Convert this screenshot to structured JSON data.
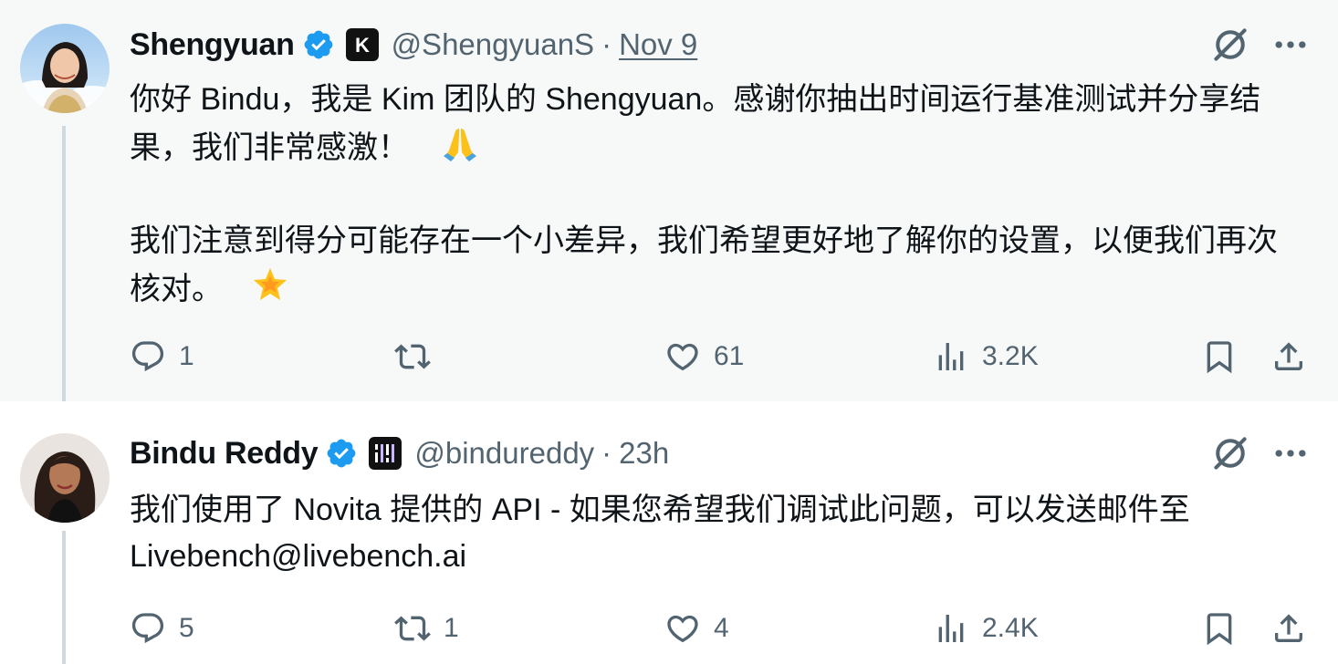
{
  "tweets": [
    {
      "author": {
        "name": "Shengyuan",
        "handle": "@ShengyuanS",
        "affiliate": "Kim"
      },
      "time": "Nov 9",
      "text": [
        "你好 Bindu，我是 Kim 团队的 Shengyuan。感谢你抽出时间运行基准测试并分享结果，我们非常感激！",
        "我们注意到得分可能存在一个小差异，我们希望更好地了解你的设置，以便我们再次核对。"
      ],
      "emojis": [
        "folded-hands",
        "glowing-star"
      ],
      "stats": {
        "replies": "1",
        "reposts": "",
        "likes": "61",
        "views": "3.2K"
      }
    },
    {
      "author": {
        "name": "Bindu Reddy",
        "handle": "@bindureddy",
        "affiliate": "LiveBench"
      },
      "time": "23h",
      "text": [
        "我们使用了 Novita 提供的 API - 如果您希望我们调试此问题，可以发送邮件至 Livebench@livebench.ai"
      ],
      "stats": {
        "replies": "5",
        "reposts": "1",
        "likes": "4",
        "views": "2.4K"
      }
    }
  ],
  "ui": {
    "dot": "·"
  },
  "icons": [
    "verified-badge-icon",
    "affiliate-badge-icon",
    "grok-icon",
    "more-icon",
    "reply-icon",
    "repost-icon",
    "like-icon",
    "views-icon",
    "bookmark-icon",
    "share-icon"
  ],
  "colors": {
    "verified": "#1d9bf0",
    "secondary_text": "#536471",
    "primary_text": "#0f1419",
    "highlight_bg": "#f7f9f9",
    "thread_line": "#cfd9de"
  }
}
